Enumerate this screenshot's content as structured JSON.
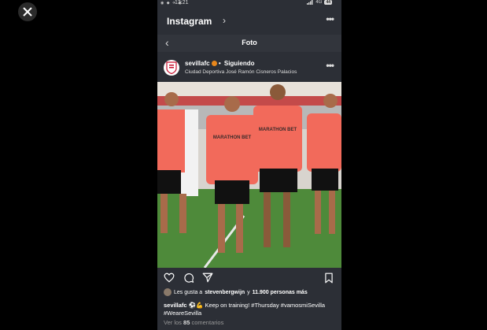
{
  "status_bar": {
    "time": "13:21",
    "network": "4G",
    "battery": "44"
  },
  "header": {
    "app_title": "Instagram"
  },
  "subheader": {
    "title": "Foto"
  },
  "post": {
    "username": "sevillafc",
    "separator": "•",
    "follow_state": "Siguiendo",
    "location": "Ciudad Deportiva José Ramón Cisneros Palacios",
    "shirt_text": "MARATHON BET",
    "likes": {
      "prefix": "Les gusta a",
      "user": "stevenbergwijn",
      "connector": "y",
      "count_text": "11.900 personas más"
    },
    "caption": {
      "username": "sevillafc",
      "emoji": "⚽️💪",
      "text": "Keep on training! #Thursday #vamosmiSevilla #WeareSevilla"
    },
    "comments": {
      "prefix": "Ver los",
      "count": "85",
      "suffix": "comentarios"
    }
  },
  "icons": [
    "close-icon",
    "signal-icon",
    "battery-icon",
    "chevron-right-icon",
    "more-icon",
    "back-icon",
    "verified-icon",
    "heart-icon",
    "comment-icon",
    "share-icon",
    "bookmark-icon"
  ],
  "colors": {
    "background": "#000000",
    "panel": "#2c2f36",
    "shirt": "#f26a5b",
    "grass": "#4e8a3a",
    "verified": "#e8871c"
  }
}
